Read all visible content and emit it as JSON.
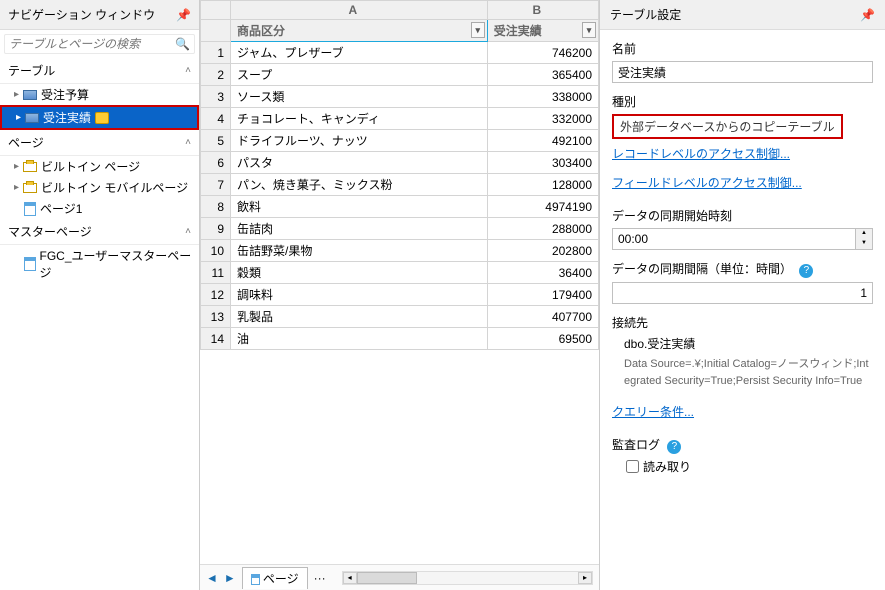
{
  "nav": {
    "title": "ナビゲーション ウィンドウ",
    "search_placeholder": "テーブルとページの検索",
    "sec_tables": "テーブル",
    "sec_pages": "ページ",
    "sec_master": "マスターページ",
    "tree_budget": "受注予算",
    "tree_actual": "受注実績",
    "tree_builtin_pages": "ビルトイン ページ",
    "tree_builtin_mobile": "ビルトイン モバイルページ",
    "tree_page1": "ページ1",
    "tree_master": "FGC_ユーザーマスターページ"
  },
  "grid": {
    "col_a": "商品区分",
    "col_b": "受注実績",
    "rows": [
      {
        "a": "ジャム、プレザーブ",
        "b": 746200
      },
      {
        "a": "スープ",
        "b": 365400
      },
      {
        "a": "ソース類",
        "b": 338000
      },
      {
        "a": "チョコレート、キャンディ",
        "b": 332000
      },
      {
        "a": "ドライフルーツ、ナッツ",
        "b": 492100
      },
      {
        "a": "パスタ",
        "b": 303400
      },
      {
        "a": "パン、焼き菓子、ミックス粉",
        "b": 128000
      },
      {
        "a": "飲料",
        "b": 4974190
      },
      {
        "a": "缶詰肉",
        "b": 288000
      },
      {
        "a": "缶詰野菜/果物",
        "b": 202800
      },
      {
        "a": "穀類",
        "b": 36400
      },
      {
        "a": "調味料",
        "b": 179400
      },
      {
        "a": "乳製品",
        "b": 407700
      },
      {
        "a": "油",
        "b": 69500
      }
    ],
    "tab_label": "ページ"
  },
  "settings": {
    "title": "テーブル設定",
    "name_label": "名前",
    "name_value": "受注実績",
    "type_label": "種別",
    "type_value": "外部データベースからのコピーテーブル",
    "link_record": "レコードレベルのアクセス制御...",
    "link_field": "フィールドレベルのアクセス制御...",
    "sync_start_label": "データの同期開始時刻",
    "sync_start_value": "00:00",
    "sync_interval_label": "データの同期間隔（単位：時間）",
    "sync_interval_value": "1",
    "conn_label": "接続先",
    "conn_target": "dbo.受注実績",
    "conn_string": "Data Source=.¥;Initial Catalog=ノースウィンド;Integrated Security=True;Persist Security Info=True",
    "link_query": "クエリー条件...",
    "audit_label": "監査ログ",
    "audit_read": "読み取り"
  }
}
